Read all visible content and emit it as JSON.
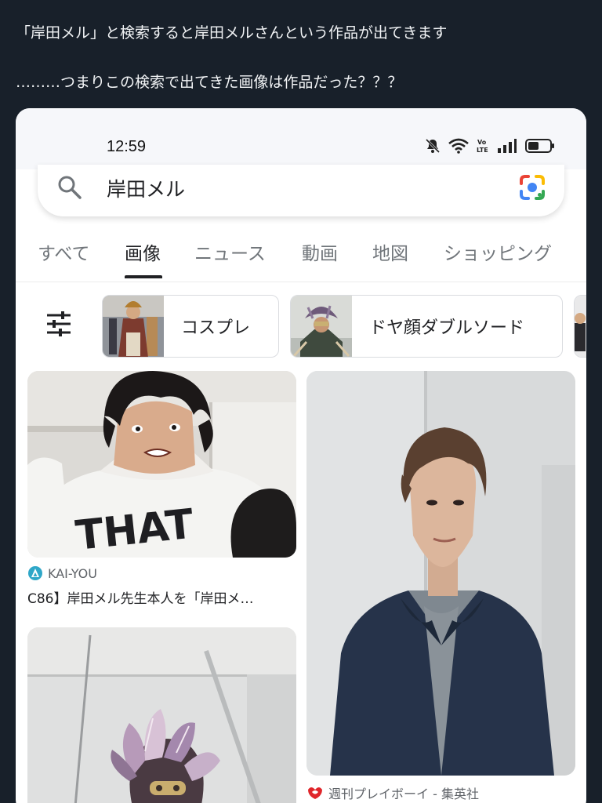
{
  "post": {
    "line1": "「岸田メル」と検索すると岸田メルさんという作品が出てきます",
    "line2": "………つまりこの検索で出てきた画像は作品だった？？？"
  },
  "status_bar": {
    "time": "12:59",
    "icons": [
      "bell-off-icon",
      "wifi-icon",
      "volte-icon",
      "signal-icon",
      "battery-icon"
    ]
  },
  "search": {
    "query": "岸田メル"
  },
  "tabs": [
    {
      "label": "すべて",
      "active": false
    },
    {
      "label": "画像",
      "active": true
    },
    {
      "label": "ニュース",
      "active": false
    },
    {
      "label": "動画",
      "active": false
    },
    {
      "label": "地図",
      "active": false
    },
    {
      "label": "ショッピング",
      "active": false
    }
  ],
  "filter_chips": [
    {
      "label": "コスプレ"
    },
    {
      "label": "ドヤ顔ダブルソード"
    }
  ],
  "results": [
    {
      "source": "KAI-YOU",
      "caption": "C86】岸田メル先生本人を「岸田メ…",
      "shirt_text": "THAT"
    },
    {
      "source": "週刊プレイボーイ - 集英社",
      "caption": ""
    },
    {
      "source": "",
      "caption": ""
    }
  ],
  "colors": {
    "page_bg": "#18202a",
    "card_bg": "#ffffff",
    "text_primary": "#202124",
    "text_secondary": "#70757a",
    "kaiyou_icon": "#2fa7c8",
    "playboy_icon": "#e0262b"
  }
}
